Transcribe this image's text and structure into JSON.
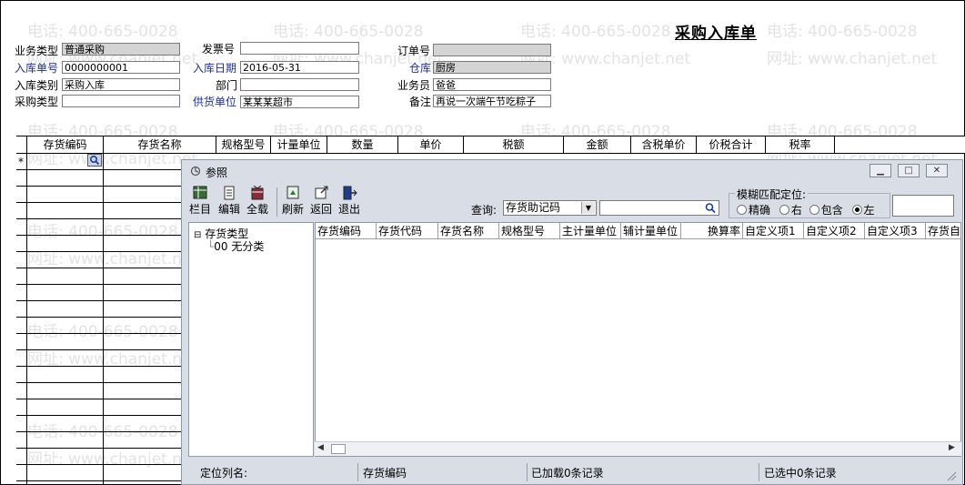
{
  "document": {
    "title": "采购入库单",
    "watermark_phone": "电话: 400-665-0028",
    "watermark_site": "网址: www.chanjet.net"
  },
  "form": {
    "business_type_label": "业务类型",
    "business_type_value": "普通采购",
    "invoice_no_label": "发票号",
    "invoice_no_value": "",
    "order_no_label": "订单号",
    "order_no_value": "",
    "receipt_no_label": "入库单号",
    "receipt_no_value": "0000000001",
    "receipt_date_label": "入库日期",
    "receipt_date_value": "2016-05-31",
    "warehouse_label": "仓库",
    "warehouse_value": "厨房",
    "receipt_category_label": "入库类别",
    "receipt_category_value": "采购入库",
    "department_label": "部门",
    "department_value": "",
    "salesperson_label": "业务员",
    "salesperson_value": "爸爸",
    "purchase_type_label": "采购类型",
    "purchase_type_value": "",
    "supplier_label": "供货单位",
    "supplier_value": "某某某超市",
    "remark_label": "备注",
    "remark_value": "再说一次端午节吃粽子"
  },
  "grid": {
    "columns": [
      "存货编码",
      "存货名称",
      "规格型号",
      "计量单位",
      "数量",
      "单价",
      "税额",
      "金额",
      "含税单价",
      "价税合计",
      "税率"
    ],
    "new_row_marker": "*"
  },
  "dialog": {
    "title": "参照",
    "toolbar": [
      "栏目",
      "编辑",
      "全载",
      "刷新",
      "返回",
      "退出"
    ],
    "query_label": "查询:",
    "query_field": "存货助记码",
    "query_value": "",
    "fuzzy_label": "模糊匹配定位:",
    "match_options": [
      "精确",
      "右",
      "包含",
      "左"
    ],
    "match_selected": "左",
    "tree_root": "存货类型",
    "tree_child": "00 无分类",
    "list_columns": [
      "存货编码",
      "存货代码",
      "存货名称",
      "规格型号",
      "主计量单位",
      "辅计量单位",
      "换算率",
      "自定义项1",
      "自定义项2",
      "自定义项3",
      "存货自"
    ],
    "status_locate_label": "定位列名:",
    "status_locate_value": "存货编码",
    "status_loaded": "已加载0条记录",
    "status_selected": "已选中0条记录"
  }
}
